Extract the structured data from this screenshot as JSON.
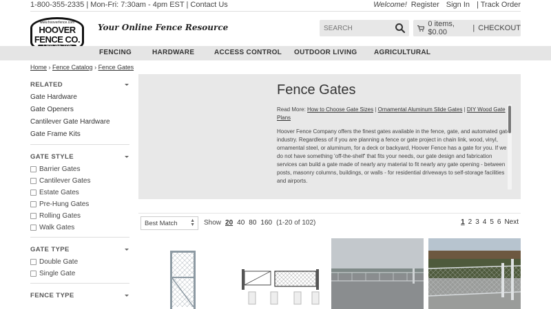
{
  "topbar": {
    "phone": "1-800-355-2335",
    "hours": "Mon-Fri: 7:30am - 4pm EST",
    "contact": "Contact Us",
    "welcome": "Welcome!",
    "register": "Register",
    "signin": "Sign In",
    "track": "Track Order"
  },
  "header": {
    "logo_small": "www.hooverfence.com",
    "logo_line1": "HOOVER",
    "logo_line2": "FENCE CO.",
    "logo_phone": "1-800-355-2335",
    "tagline": "Your Online Fence Resource",
    "search_placeholder": "SEARCH",
    "cart_items": "0 items, $0.00",
    "checkout": "CHECKOUT"
  },
  "nav": [
    "FENCING",
    "HARDWARE",
    "ACCESS CONTROL",
    "OUTDOOR LIVING",
    "AGRICULTURAL"
  ],
  "breadcrumb": [
    "Home",
    "Fence Catalog",
    "Fence Gates"
  ],
  "sidebar": {
    "related": {
      "title": "RELATED",
      "items": [
        "Gate Hardware",
        "Gate Openers",
        "Cantilever Gate Hardware",
        "Gate Frame Kits"
      ]
    },
    "gate_style": {
      "title": "GATE STYLE",
      "items": [
        "Barrier Gates",
        "Cantilever Gates",
        "Estate Gates",
        "Pre-Hung Gates",
        "Rolling Gates",
        "Walk Gates"
      ]
    },
    "gate_type": {
      "title": "GATE TYPE",
      "items": [
        "Double Gate",
        "Single Gate"
      ]
    },
    "fence_type": {
      "title": "FENCE TYPE"
    }
  },
  "panel": {
    "title": "Fence Gates",
    "read_more": "Read More:",
    "links": [
      "How to Choose Gate Sizes",
      "Ornamental Aluminum Slide Gates",
      "DIY Wood Gate Plans"
    ],
    "body": "Hoover Fence Company offers the finest gates available in the fence, gate, and automated gate industry. Regardless of if you are planning a fence or gate project in chain link, wood, vinyl, ornamental steel, or aluminum, for a deck or backyard, Hoover Fence has a gate for you. If we do not have something 'off-the-shelf' that fits your needs, our gate design and fabrication services can build a gate made of nearly any material to fit nearly any gate opening - between posts, masonry columns, buildings, or walls - for residential driveways to self-storage facilities and airports."
  },
  "toolbar": {
    "sort": "Best Match",
    "show_label": "Show",
    "show_options": [
      "20",
      "40",
      "80",
      "160"
    ],
    "range": "(1-20 of 102)",
    "pages": [
      "1",
      "2",
      "3",
      "4",
      "5",
      "6"
    ],
    "next": "Next"
  },
  "colors": {
    "nav_bg": "#e5e5e5",
    "panel_bg": "#e8e8e8",
    "text": "#333333"
  }
}
